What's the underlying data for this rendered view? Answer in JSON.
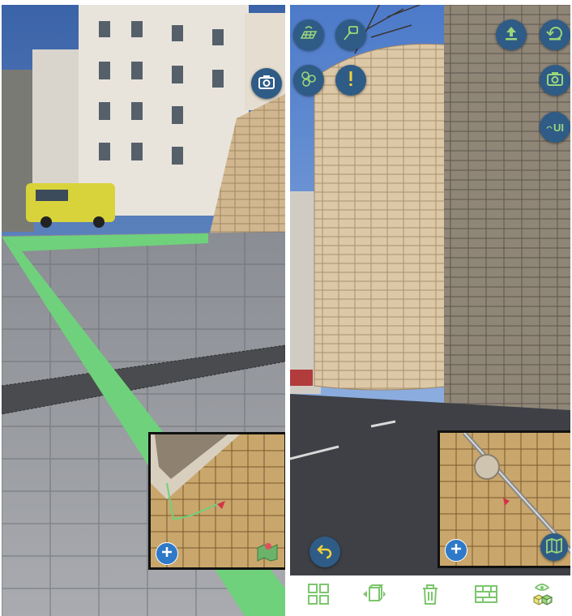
{
  "left_screen": {
    "toolbar_buttons": [
      {
        "icon": "camera-capture-icon"
      }
    ],
    "minimap": {
      "add_button_icon": "plus-icon",
      "map_button_icon": "map-pin-icon"
    },
    "path_color": "#6fd17c"
  },
  "right_screen": {
    "toolbar_buttons": [
      {
        "icon": "grid-surface-icon"
      },
      {
        "icon": "tag-icon"
      },
      {
        "icon": "upload-icon"
      },
      {
        "icon": "undo-icon"
      },
      {
        "icon": "group-circles-icon"
      },
      {
        "icon": "alert-icon"
      },
      {
        "icon": "camera-capture-icon"
      },
      {
        "icon": "ui-toggle-icon",
        "label": "UI"
      },
      {
        "icon": "back-arrow-icon"
      }
    ],
    "minimap": {
      "add_button_icon": "plus-icon",
      "map_button_icon": "map-icon"
    },
    "bottom_toolbar": [
      {
        "icon": "grid-view-icon"
      },
      {
        "icon": "3d-box-icon"
      },
      {
        "icon": "trash-icon"
      },
      {
        "icon": "wall-icon"
      },
      {
        "icon": "visibility-cubes-icon"
      }
    ]
  },
  "colors": {
    "button_bg": "#2e5c86",
    "toolbar_icon": "#7cc66d",
    "minimap_bg": "#c9a66b",
    "path_green": "#6fd17c"
  }
}
